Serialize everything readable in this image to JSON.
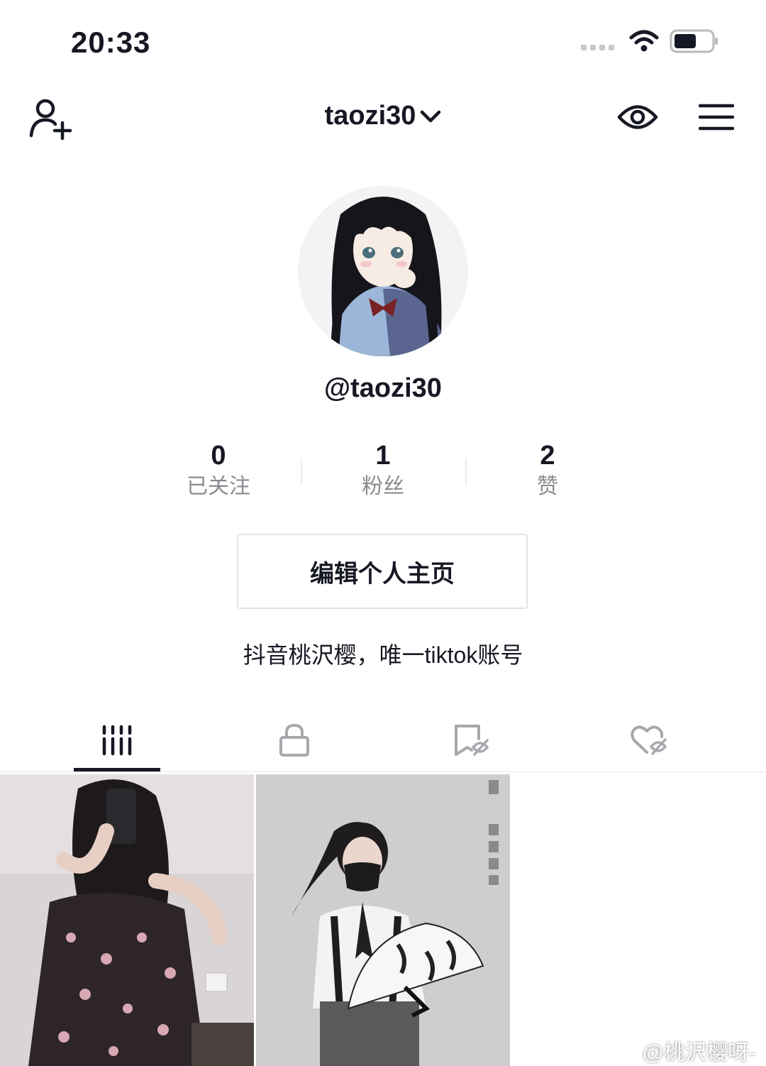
{
  "status_bar": {
    "time": "20:33"
  },
  "header": {
    "username": "taozi30"
  },
  "profile": {
    "handle": "@taozi30",
    "bio": "抖音桃沢樱，唯一tiktok账号"
  },
  "stats": [
    {
      "value": "0",
      "label": "已关注"
    },
    {
      "value": "1",
      "label": "粉丝"
    },
    {
      "value": "2",
      "label": "赞"
    }
  ],
  "edit_button": {
    "label": "编辑个人主页"
  },
  "tabs": [
    {
      "icon": "videos-grid-icon",
      "active": true
    },
    {
      "icon": "lock-icon",
      "active": false
    },
    {
      "icon": "bookmark-hidden-icon",
      "active": false
    },
    {
      "icon": "liked-hidden-icon",
      "active": false
    }
  ],
  "watermark": {
    "text": "@桃沢樱呀-"
  },
  "colors": {
    "text": "#161823",
    "secondary": "#8a8b91",
    "border": "#e3e3e4"
  }
}
